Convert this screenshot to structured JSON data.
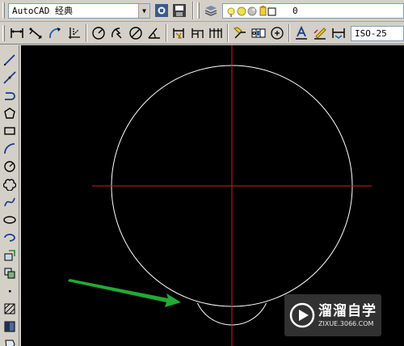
{
  "toolbar_top": {
    "workspace_value": "AutoCAD 经典",
    "layer_value": "0"
  },
  "toolbar_dim": {
    "dimstyle_value": "ISO-25"
  },
  "canvas": {
    "background": "#000000",
    "crosshair_color": "#d42020",
    "geometry_color": "#ffffff",
    "arrow_color": "#22aa33"
  },
  "watermark": {
    "title": "溜溜自学",
    "url": "ZIXUE.3066.COM"
  },
  "left_toolbar_icons": [
    "line-icon",
    "construction-line-icon",
    "polyline-icon",
    "polygon-icon",
    "rectangle-icon",
    "arc-icon",
    "circle-icon",
    "revision-cloud-icon",
    "spline-icon",
    "ellipse-icon",
    "ellipse-arc-icon",
    "insert-block-icon",
    "make-block-icon",
    "point-icon",
    "hatch-icon",
    "gradient-icon",
    "region-icon"
  ]
}
